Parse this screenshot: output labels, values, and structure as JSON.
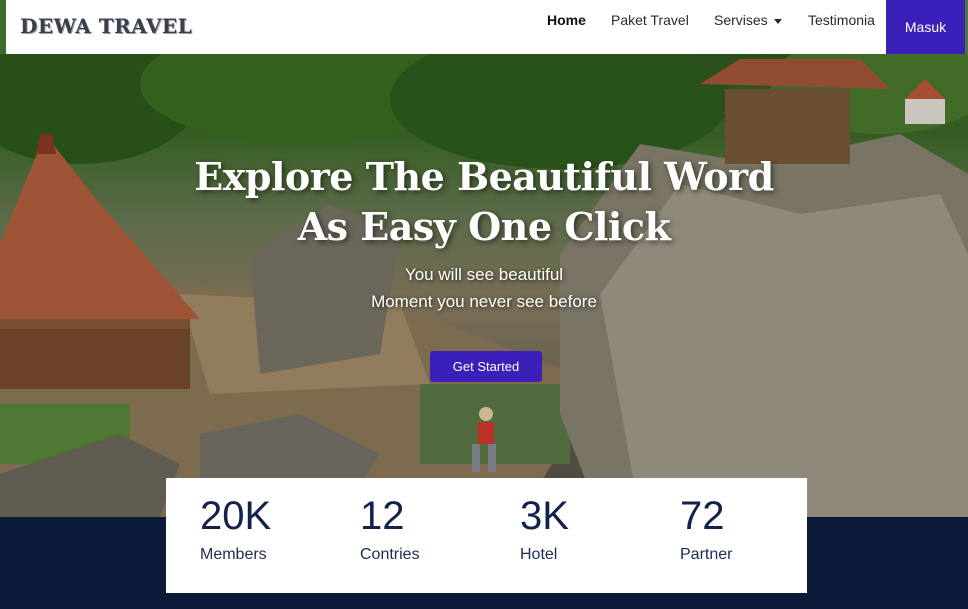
{
  "brand": {
    "name": "DEWA TRAVEL"
  },
  "nav": {
    "home": "Home",
    "paket": "Paket Travel",
    "servises": "Servises",
    "testimonia": "Testimonia",
    "login": "Masuk"
  },
  "hero": {
    "title_line1": "Explore The Beautiful Word",
    "title_line2": "As Easy One Click",
    "sub_line1": "You will see beautiful",
    "sub_line2": "Moment you never see before",
    "cta": "Get Started"
  },
  "stats": [
    {
      "value": "20K",
      "label": "Members"
    },
    {
      "value": "12",
      "label": "Contries"
    },
    {
      "value": "3K",
      "label": "Hotel"
    },
    {
      "value": "72",
      "label": "Partner"
    }
  ],
  "colors": {
    "accent": "#3a1fb8",
    "dark_band": "#0c1a3a",
    "stat_text": "#12224a"
  },
  "icons": {
    "dropdown": "caret-down-icon"
  }
}
